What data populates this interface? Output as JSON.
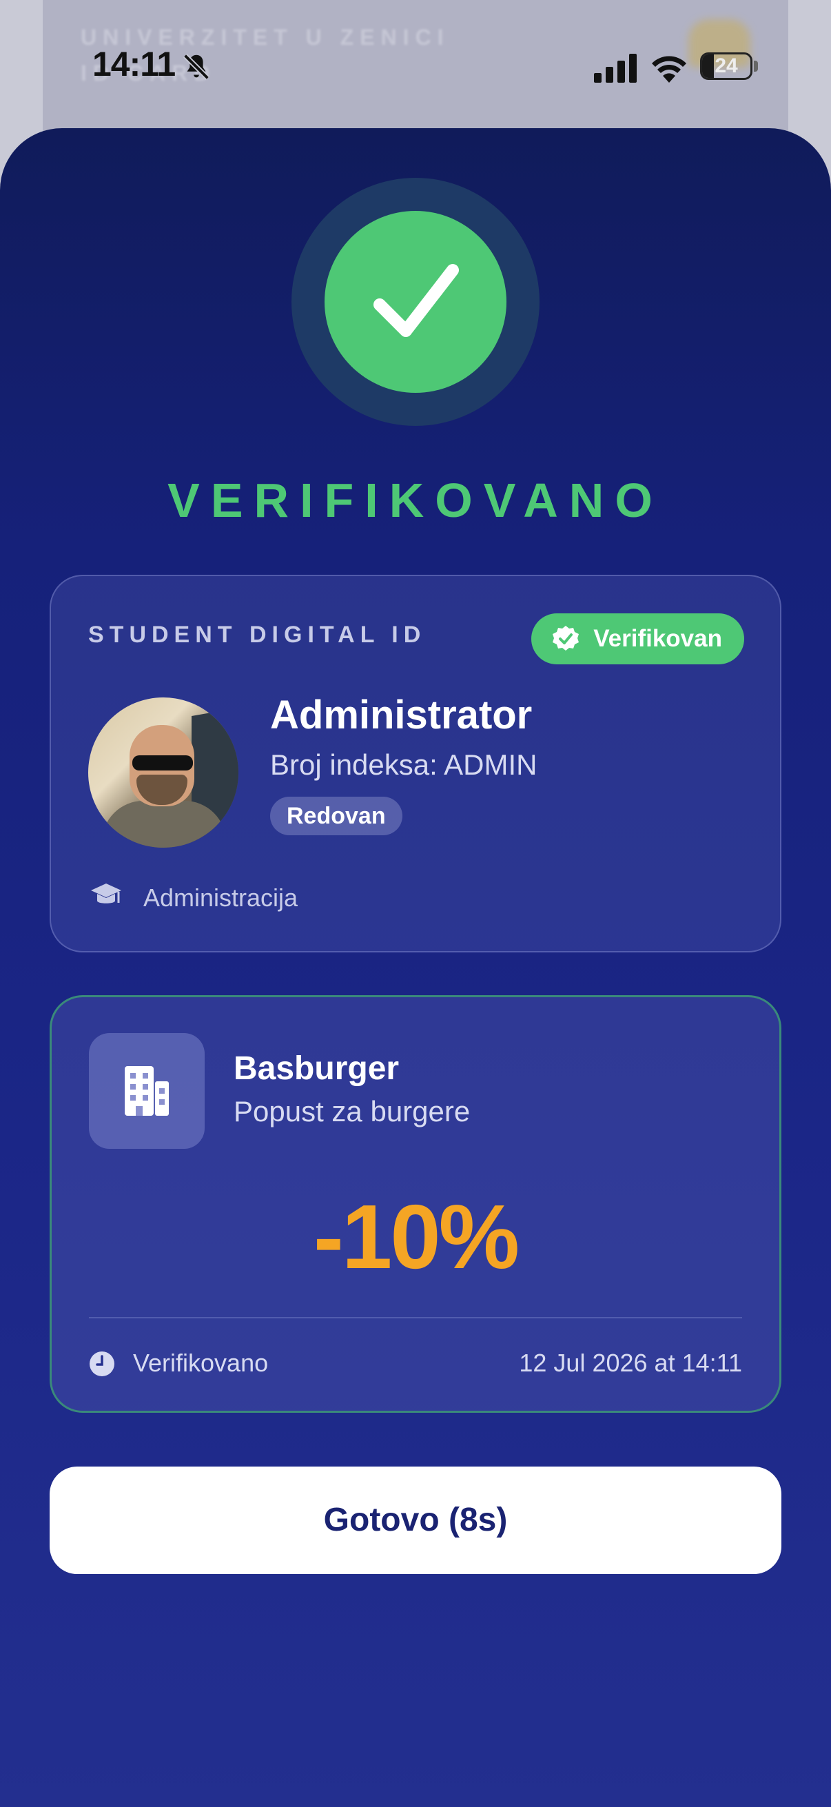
{
  "background_card": {
    "line1": "UNIVERZITET U ZENICI",
    "line2": "ID CARD"
  },
  "status_bar": {
    "time": "14:11",
    "battery": "24"
  },
  "result": {
    "title": "VERIFIKOVANO"
  },
  "id_card": {
    "label": "STUDENT DIGITAL ID",
    "badge": "Verifikovan",
    "name": "Administrator",
    "index": "Broj indeksa: ADMIN",
    "status": "Redovan",
    "department": "Administracija"
  },
  "discount_card": {
    "partner_name": "Basburger",
    "description": "Popust za burgere",
    "discount": "-10%",
    "footer_label": "Verifikovano",
    "timestamp": "12 Jul 2026 at 14:11"
  },
  "done_button": {
    "label": "Gotovo (8s)"
  },
  "colors": {
    "success": "#4ec875",
    "discount": "#f5a524",
    "sheet_top": "#101b5a",
    "sheet_bottom": "#232f8f"
  },
  "icons": [
    "bell-off-icon",
    "signal-icon",
    "wifi-icon",
    "battery-icon",
    "checkmark-icon",
    "verified-badge-icon",
    "graduation-cap-icon",
    "building-icon",
    "clock-icon"
  ]
}
